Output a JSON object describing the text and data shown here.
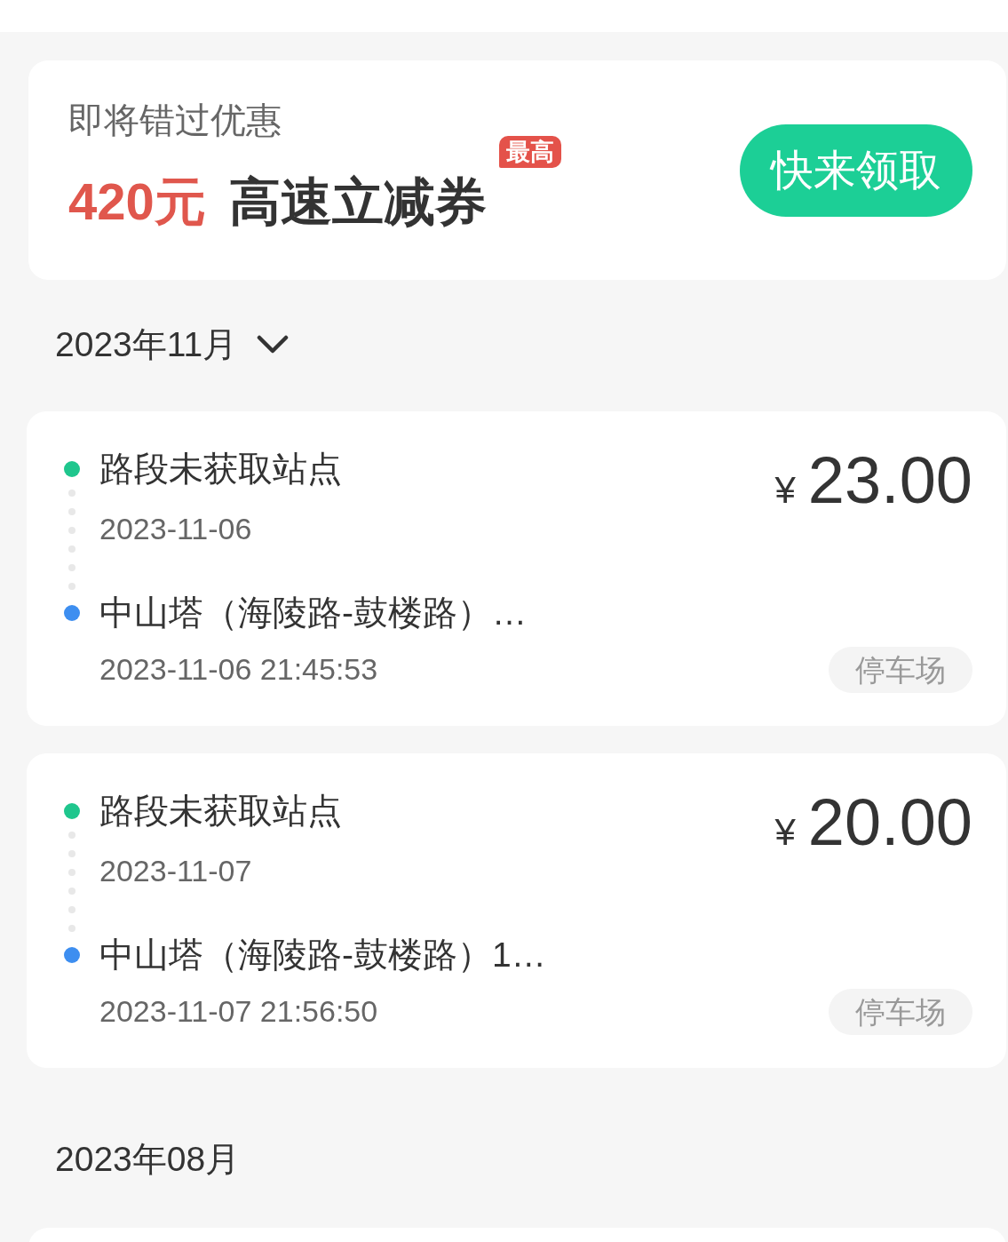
{
  "promo": {
    "caption": "即将错过优惠",
    "amount": "420元",
    "title": "高速立减券",
    "badge": "最高",
    "button": "快来领取"
  },
  "groups": [
    {
      "month": "2023年11月",
      "dropdown": true,
      "records": [
        {
          "stops": [
            {
              "name": "路段未获取站点",
              "time": "2023-11-06",
              "color": "#1fc68d"
            },
            {
              "name": "中山塔（海陵路-鼓楼路）…",
              "time": "2023-11-06 21:45:53",
              "color": "#3d8ef0"
            }
          ],
          "currency": "¥",
          "amount": "23.00",
          "tag": "停车场"
        },
        {
          "stops": [
            {
              "name": "路段未获取站点",
              "time": "2023-11-07",
              "color": "#1fc68d"
            },
            {
              "name": "中山塔（海陵路-鼓楼路）1…",
              "time": "2023-11-07 21:56:50",
              "color": "#3d8ef0"
            }
          ],
          "currency": "¥",
          "amount": "20.00",
          "tag": "停车场"
        }
      ]
    },
    {
      "month": "2023年08月",
      "dropdown": false
    }
  ]
}
